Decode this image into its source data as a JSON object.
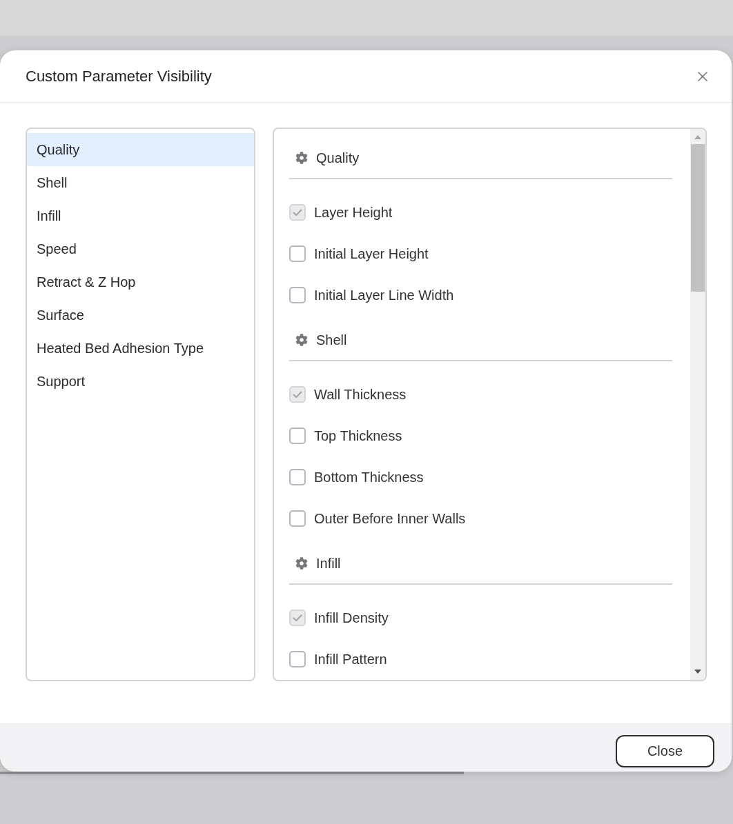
{
  "dialog": {
    "title": "Custom Parameter Visibility"
  },
  "categories": [
    {
      "label": "Quality",
      "selected": true
    },
    {
      "label": "Shell",
      "selected": false
    },
    {
      "label": "Infill",
      "selected": false
    },
    {
      "label": "Speed",
      "selected": false
    },
    {
      "label": "Retract & Z Hop",
      "selected": false
    },
    {
      "label": "Surface",
      "selected": false
    },
    {
      "label": "Heated Bed Adhesion Type",
      "selected": false
    },
    {
      "label": "Support",
      "selected": false
    }
  ],
  "sections": [
    {
      "title": "Quality",
      "parameters": [
        {
          "label": "Layer Height",
          "checked": true,
          "disabled": true
        },
        {
          "label": "Initial Layer Height",
          "checked": false,
          "disabled": false
        },
        {
          "label": "Initial Layer Line Width",
          "checked": false,
          "disabled": false
        }
      ]
    },
    {
      "title": "Shell",
      "parameters": [
        {
          "label": "Wall Thickness",
          "checked": true,
          "disabled": true
        },
        {
          "label": "Top Thickness",
          "checked": false,
          "disabled": false
        },
        {
          "label": "Bottom Thickness",
          "checked": false,
          "disabled": false
        },
        {
          "label": "Outer Before Inner Walls",
          "checked": false,
          "disabled": false
        }
      ]
    },
    {
      "title": "Infill",
      "parameters": [
        {
          "label": "Infill Density",
          "checked": true,
          "disabled": true
        },
        {
          "label": "Infill Pattern",
          "checked": false,
          "disabled": false
        }
      ]
    }
  ],
  "footer": {
    "button": "Close"
  }
}
